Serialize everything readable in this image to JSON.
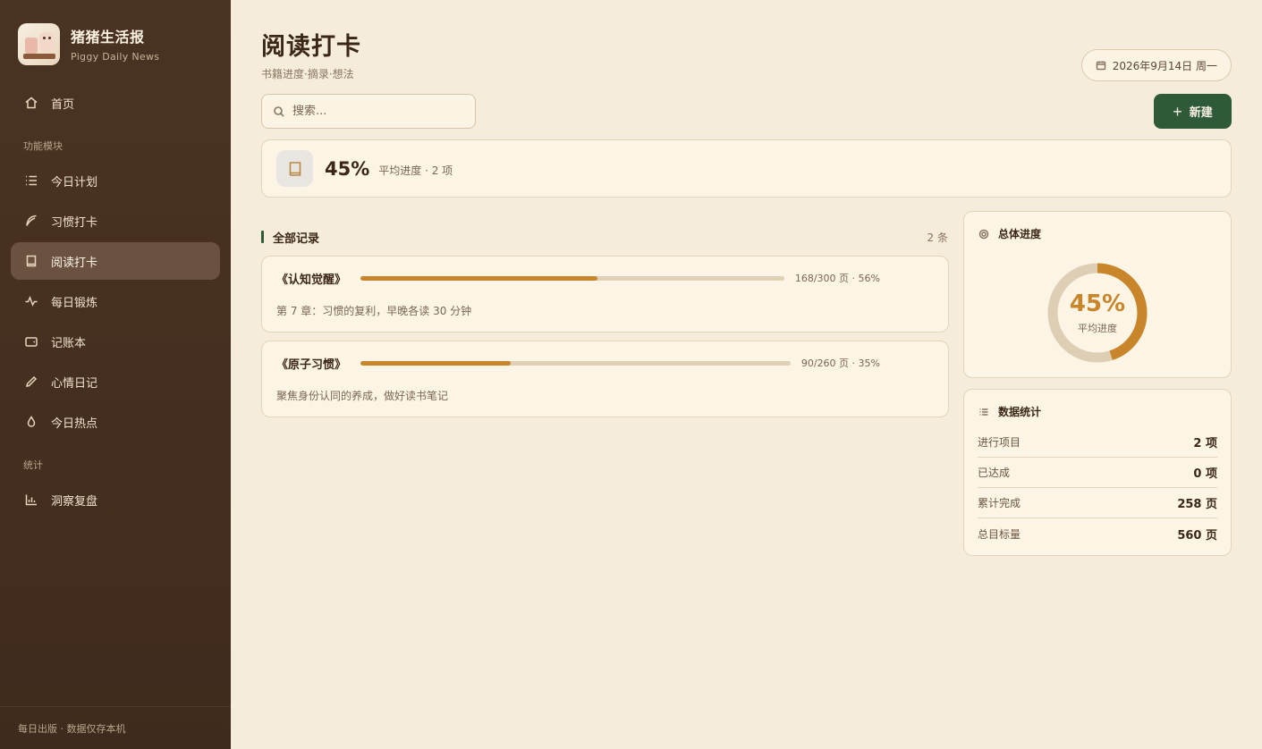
{
  "brand": {
    "title": "猪猪生活报",
    "subtitle": "Piggy Daily News"
  },
  "nav": {
    "home": "首页",
    "section_modules": "功能模块",
    "items": [
      {
        "label": "今日计划",
        "icon": "list-icon"
      },
      {
        "label": "习惯打卡",
        "icon": "feather-icon"
      },
      {
        "label": "阅读打卡",
        "icon": "book-icon",
        "active": true
      },
      {
        "label": "每日锻炼",
        "icon": "pulse-icon"
      },
      {
        "label": "记账本",
        "icon": "wallet-icon"
      },
      {
        "label": "心情日记",
        "icon": "pencil-icon"
      },
      {
        "label": "今日热点",
        "icon": "flame-icon"
      }
    ],
    "section_stats": "统计",
    "stats_item": "洞察复盘"
  },
  "footer": "每日出版 · 数据仅存本机",
  "header": {
    "title": "阅读打卡",
    "subtitle": "书籍进度·摘录·想法",
    "date": "2026年9月14日 周一"
  },
  "search": {
    "placeholder": "搜索..."
  },
  "new_button": "新建",
  "summary": {
    "value": "45%",
    "label": "平均进度 · 2 项"
  },
  "records_section": {
    "title": "全部记录",
    "count": "2 条"
  },
  "records": [
    {
      "title": "《认知觉醒》",
      "progress": 0.56,
      "meta": "168/300 页 · 56%",
      "note": "第 7 章：习惯的复利，早晚各读 30 分钟"
    },
    {
      "title": "《原子习惯》",
      "progress": 0.35,
      "meta": "90/260 页 · 35%",
      "note": "聚焦身份认同的养成，做好读书笔记"
    }
  ],
  "overall": {
    "title": "总体进度",
    "value": "45%",
    "fraction": 0.45,
    "label": "平均进度"
  },
  "stats": {
    "title": "数据统计",
    "rows": [
      {
        "label": "进行项目",
        "value": "2 项"
      },
      {
        "label": "已达成",
        "value": "0 项"
      },
      {
        "label": "累计完成",
        "value": "258 页"
      },
      {
        "label": "总目标量",
        "value": "560 页"
      }
    ]
  },
  "colors": {
    "accent": "#c8852a",
    "primary": "#2f5a3a",
    "sidebar": "#4b3322"
  }
}
